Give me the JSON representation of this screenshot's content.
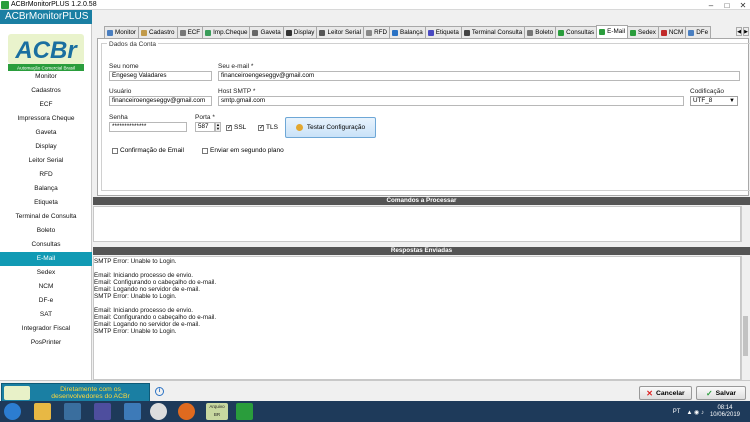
{
  "window": {
    "title": "ACBrMonitorPLUS 1.2.0.58"
  },
  "sidebar": {
    "app_name": "ACBrMonitorPLUS",
    "logo_text": "ACBr",
    "logo_tagline": "Automação Comercial Brasil",
    "active_item": "E-Mail",
    "items": [
      "Monitor",
      "Cadastros",
      "ECF",
      "Impressora Cheque",
      "Gaveta",
      "Display",
      "Leitor Serial",
      "RFD",
      "Balança",
      "Etiqueta",
      "Terminal de Consulta",
      "Boleto",
      "Consultas",
      "E-Mail",
      "Sedex",
      "NCM",
      "DF-e",
      "SAT",
      "Integrador Fiscal",
      "PosPrinter"
    ]
  },
  "tabs": [
    {
      "label": "Monitor",
      "icon_color": "#4a7fc1"
    },
    {
      "label": "Cadastro",
      "icon_color": "#c19a4a"
    },
    {
      "label": "ECF",
      "icon_color": "#777777"
    },
    {
      "label": "Imp.Cheque",
      "icon_color": "#3a9d5a"
    },
    {
      "label": "Gaveta",
      "icon_color": "#666666"
    },
    {
      "label": "Display",
      "icon_color": "#333333"
    },
    {
      "label": "Leitor Serial",
      "icon_color": "#555555"
    },
    {
      "label": "RFD",
      "icon_color": "#888888"
    },
    {
      "label": "Balança",
      "icon_color": "#2a72c4"
    },
    {
      "label": "Etiqueta",
      "icon_color": "#4a4ac1"
    },
    {
      "label": "Terminal Consulta",
      "icon_color": "#444444"
    },
    {
      "label": "Boleto",
      "icon_color": "#777777"
    },
    {
      "label": "Consultas",
      "icon_color": "#2a9d3c"
    },
    {
      "label": "E-Mail",
      "icon_color": "#2a9d3c"
    },
    {
      "label": "Sedex",
      "icon_color": "#2a9d3c"
    },
    {
      "label": "NCM",
      "icon_color": "#c12a2a"
    },
    {
      "label": "DFe",
      "icon_color": "#4a7fc1"
    }
  ],
  "tab_scroll": {
    "left": "◀",
    "right": "▶"
  },
  "email": {
    "group_title": "Dados da Conta",
    "nome_label": "Seu nome",
    "nome_value": "Engeseg Valadares",
    "email_label": "Seu e-mail *",
    "email_value": "financeiroengeseggv@gmail.com",
    "usuario_label": "Usuário",
    "usuario_value": "financeiroengeseggv@gmail.com",
    "host_label": "Host SMTP *",
    "host_value": "smtp.gmail.com",
    "codificacao_label": "Codificação",
    "codificacao_value": "UTF_8",
    "senha_label": "Senha",
    "senha_value": "**************",
    "porta_label": "Porta *",
    "porta_value": "587",
    "ssl_label": "SSL",
    "tls_label": "TLS",
    "test_button": "Testar Configuração",
    "confirm_label": "Confirmação de Email",
    "background_label": "Enviar em segundo plano"
  },
  "sections": {
    "commands": "Comandos a Processar",
    "responses": "Respostas Enviadas"
  },
  "responses": [
    "SMTP Error: Unable to Login.",
    "",
    "Email: Iniciando processo de envio.",
    "Email: Configurando o cabeçalho do e-mail.",
    "Email: Logando no servidor de e-mail.",
    "SMTP Error: Unable to Login.",
    "",
    "Email: Iniciando processo de envio.",
    "Email: Configurando o cabeçalho do e-mail.",
    "Email: Logando no servidor de e-mail.",
    "SMTP Error: Unable to Login."
  ],
  "bottom": {
    "promo_line1": "Diretamente com os",
    "promo_line2": "desenvolvedores do ACBr",
    "cancel": "Cancelar",
    "save": "Salvar"
  },
  "taskbar": {
    "lang": "PT",
    "time": "08:14",
    "date": "10/06/2019",
    "pinned_label": "Arquivo BR"
  }
}
